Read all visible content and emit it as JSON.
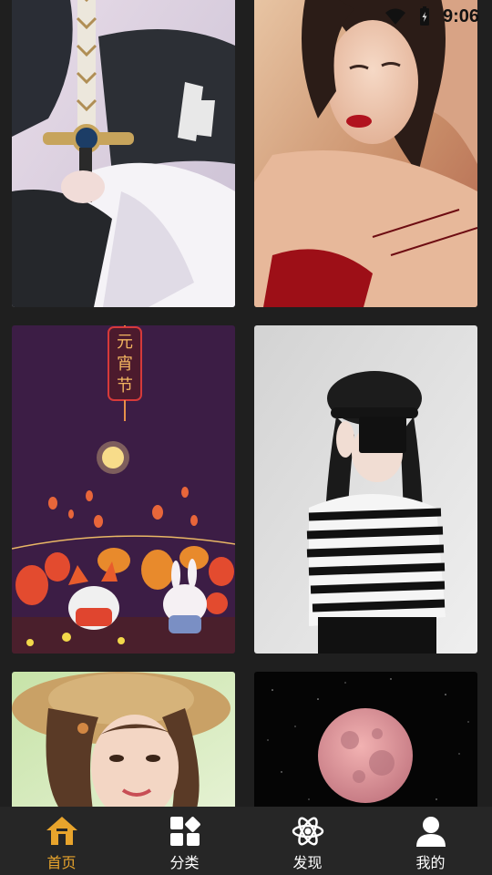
{
  "status_bar": {
    "time": "9:06",
    "icons": [
      "wifi-icon",
      "battery-icon"
    ]
  },
  "wallpapers": [
    {
      "id": "tile-1",
      "subject": "anime-swordsman"
    },
    {
      "id": "tile-2",
      "subject": "portrait-woman-red-lips"
    },
    {
      "id": "tile-3",
      "subject": "lantern-festival-illustration",
      "text": "元宵节"
    },
    {
      "id": "tile-4",
      "subject": "girl-black-hat-striped-shirt"
    },
    {
      "id": "tile-5",
      "subject": "girl-straw-hat"
    },
    {
      "id": "tile-6",
      "subject": "pink-moon-night-sky"
    }
  ],
  "tab_bar": {
    "active_color": "#e8a42c",
    "tabs": [
      {
        "label": "首页",
        "icon": "home-icon",
        "active": true
      },
      {
        "label": "分类",
        "icon": "category-icon",
        "active": false
      },
      {
        "label": "发现",
        "icon": "atom-discover-icon",
        "active": false
      },
      {
        "label": "我的",
        "icon": "user-profile-icon",
        "active": false
      }
    ]
  }
}
